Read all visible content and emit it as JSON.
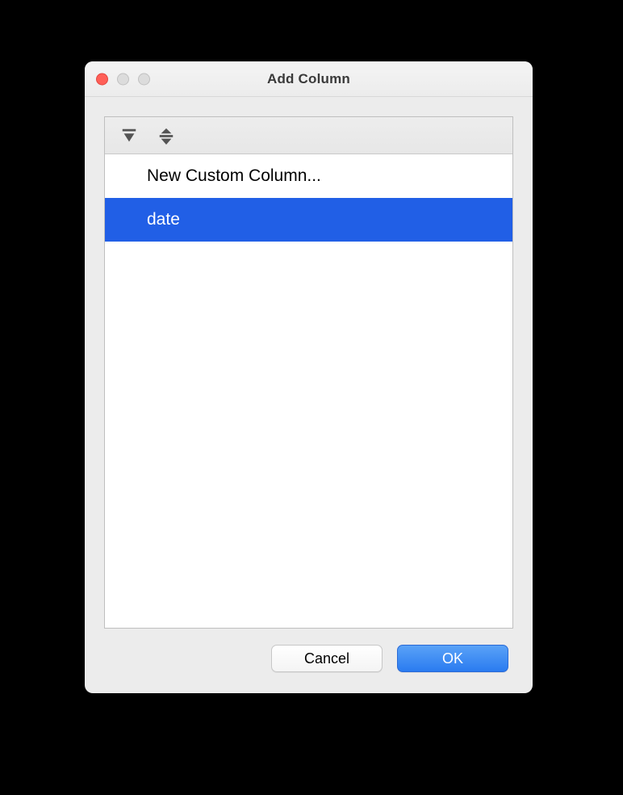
{
  "window": {
    "title": "Add Column"
  },
  "toolbar": {
    "expand_tooltip": "Expand",
    "collapse_tooltip": "Collapse"
  },
  "list": {
    "items": [
      {
        "label": "New Custom Column...",
        "selected": false
      },
      {
        "label": "date",
        "selected": true
      }
    ]
  },
  "footer": {
    "cancel_label": "Cancel",
    "ok_label": "OK"
  }
}
